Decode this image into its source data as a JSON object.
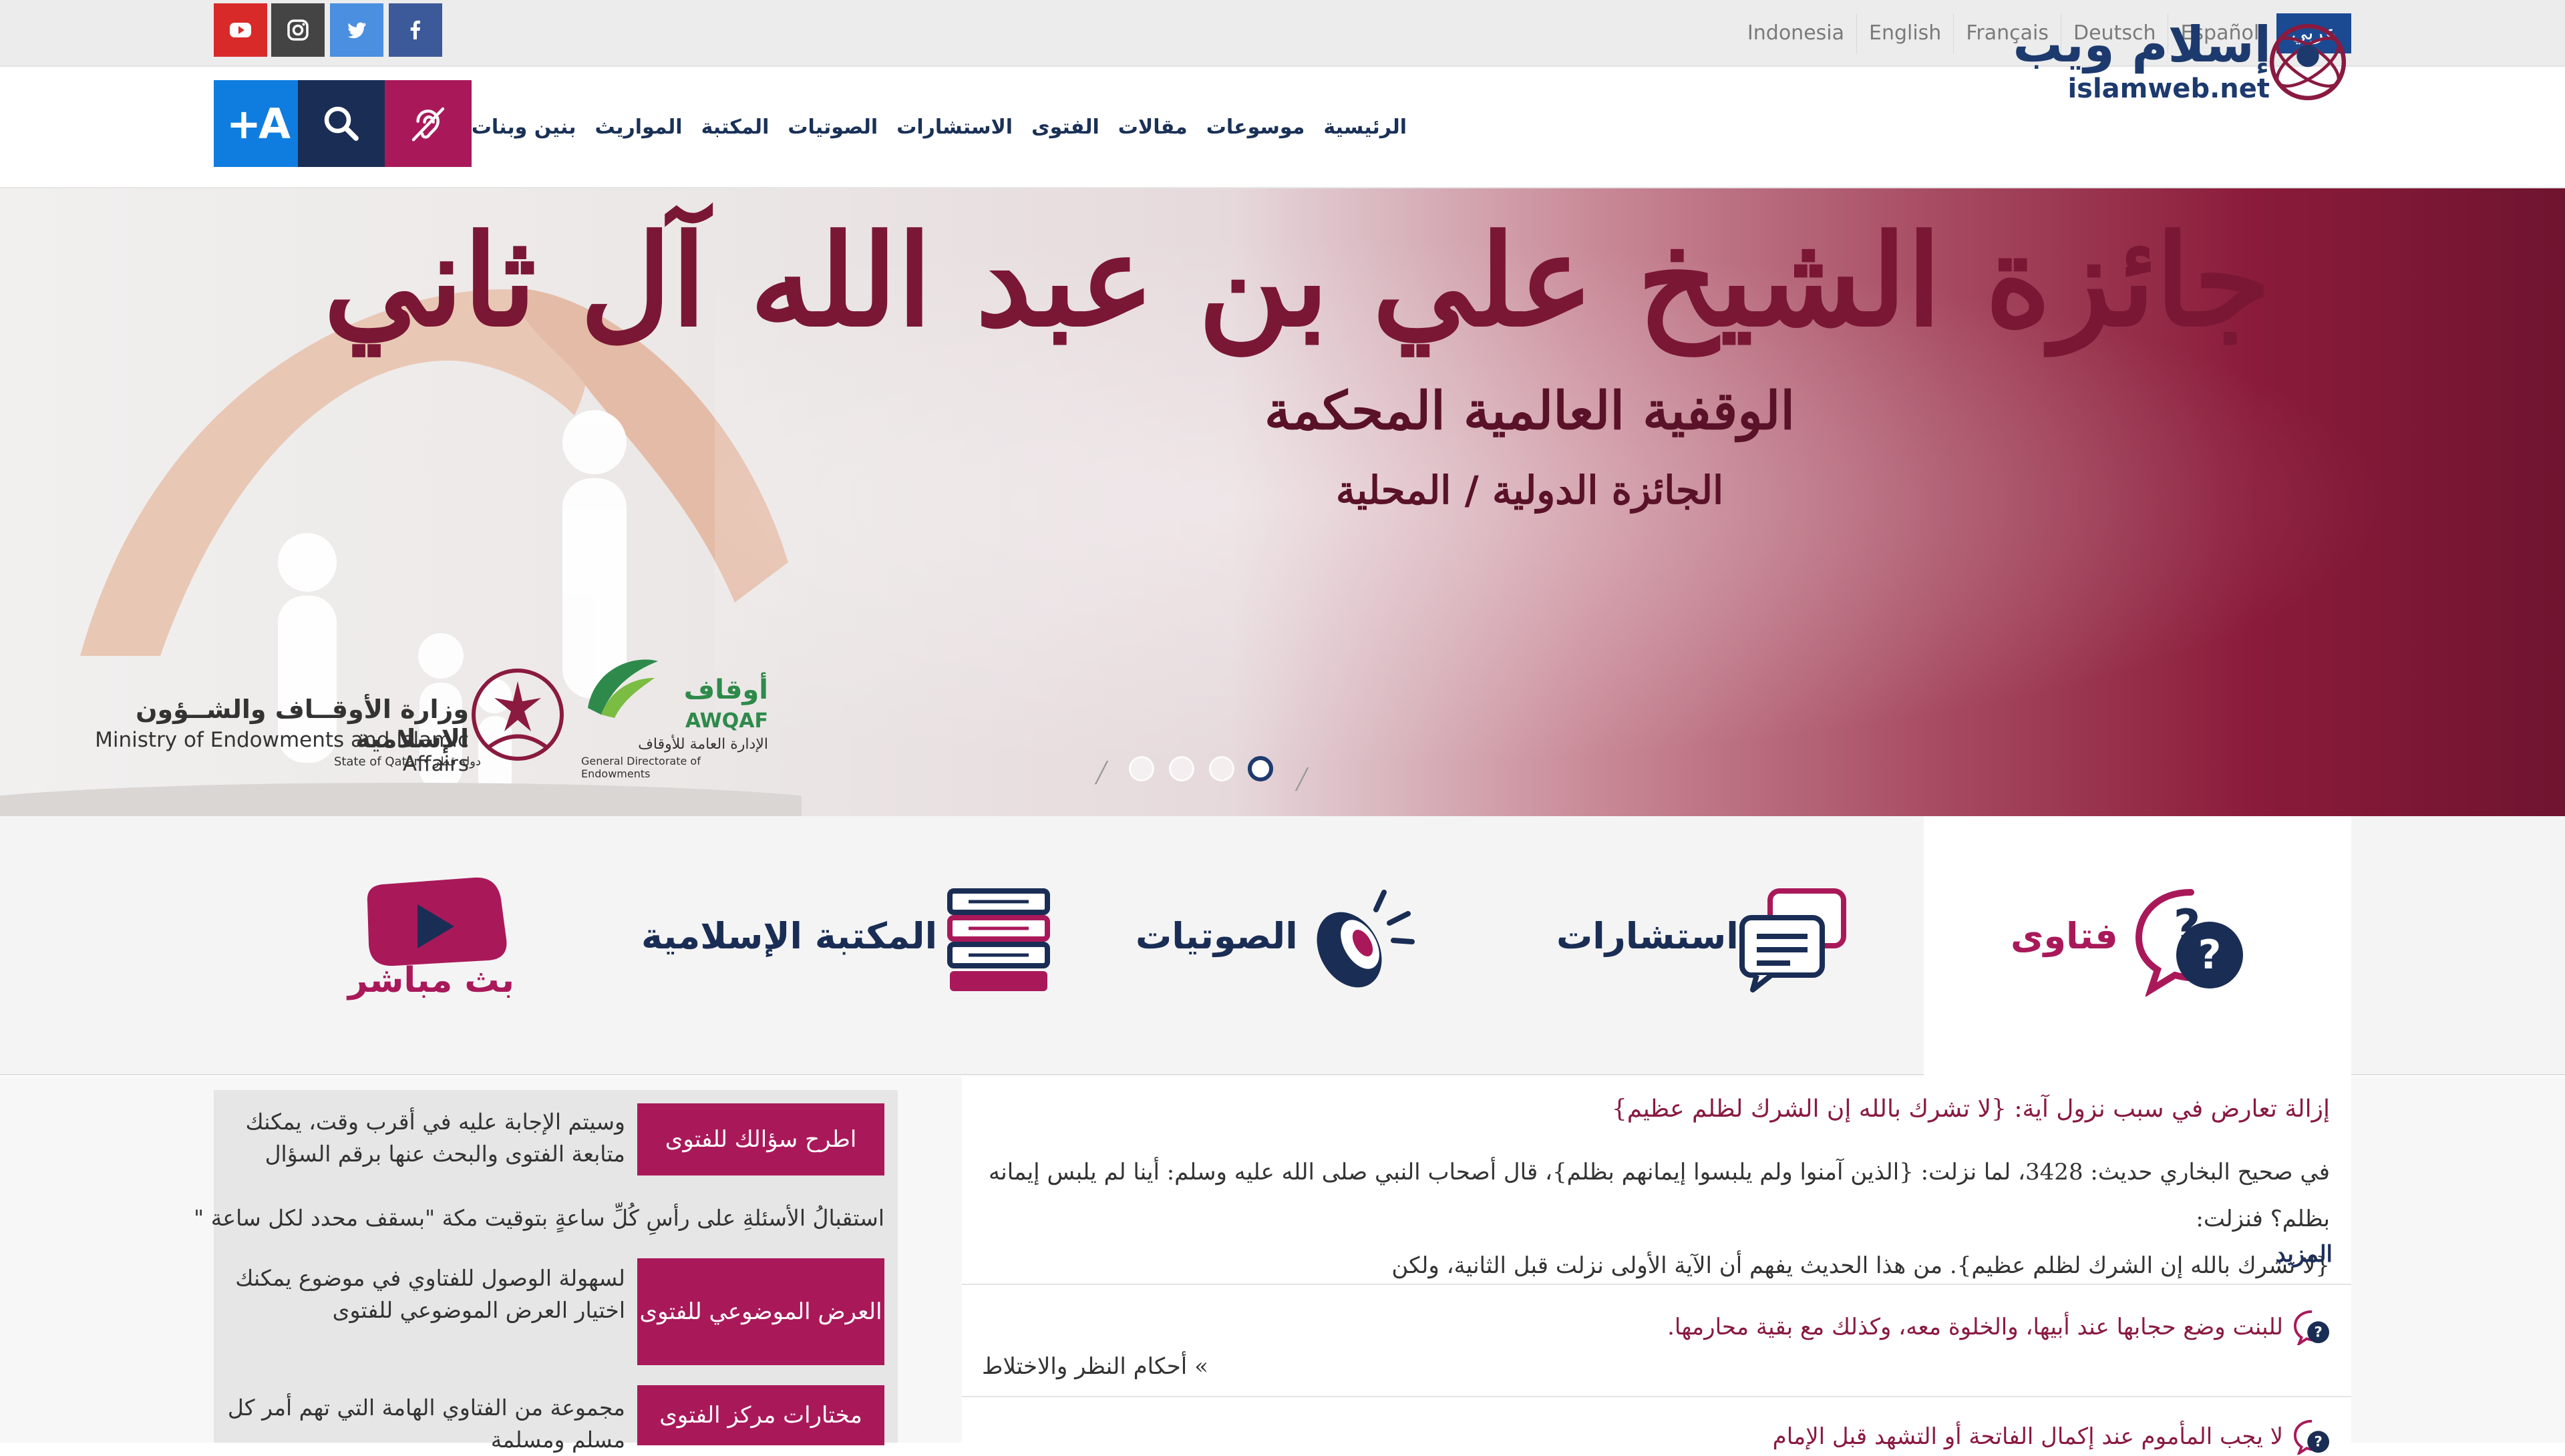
{
  "social": [
    {
      "name": "youtube",
      "icon": "youtube-icon",
      "color": "#d92a2a"
    },
    {
      "name": "instagram",
      "icon": "instagram-icon",
      "color": "#444444"
    },
    {
      "name": "twitter",
      "icon": "twitter-icon",
      "color": "#4a8fe0"
    },
    {
      "name": "facebook",
      "icon": "facebook-icon",
      "color": "#3c5a99"
    }
  ],
  "languages": [
    {
      "label": "Indonesia",
      "active": false
    },
    {
      "label": "English",
      "active": false
    },
    {
      "label": "Français",
      "active": false
    },
    {
      "label": "Deutsch",
      "active": false
    },
    {
      "label": "Español",
      "active": false
    },
    {
      "label": "عربي",
      "active": true
    }
  ],
  "logo": {
    "arabic": "إسلام ويب",
    "latin": "islamweb.net"
  },
  "nav": [
    {
      "label": "الرئيسية"
    },
    {
      "label": "موسوعات"
    },
    {
      "label": "مقالات"
    },
    {
      "label": "الفتوى"
    },
    {
      "label": "الاستشارات"
    },
    {
      "label": "الصوتيات"
    },
    {
      "label": "المكتبة"
    },
    {
      "label": "المواريث"
    },
    {
      "label": "بنين وبنات"
    }
  ],
  "nav_buttons": {
    "accessibility_icon": "hearing-icon",
    "search_icon": "search-icon",
    "font_size_label": "+A"
  },
  "colors": {
    "primary": "#1d3a6e",
    "accent": "#a9195a",
    "brand_blue": "#0f7de0",
    "navy": "#1a2d55"
  },
  "hero": {
    "title": "جائزة الشيخ علي بن عبد الله آل ثاني",
    "subtitle": "الوقفية العالمية المحكمة",
    "subtitle2": "الجائزة الدولية / المحلية",
    "ministry_ar": "وزارة الأوقــاف والشــؤون الإسلامية",
    "ministry_en": "Ministry of Endowments and Islamic Affairs",
    "ministry_state": "State of Qatar • دولة قطر",
    "awqaf_ar": "أوقاف",
    "awqaf_en": "AWQAF",
    "awqaf_sub_ar": "الإدارة العامة للأوقاف",
    "awqaf_sub_en": "General Directorate of Endowments",
    "slides": 4,
    "active_slide": 4
  },
  "sections": [
    {
      "label": "فتاوى",
      "icon": "fatwa-question-icon"
    },
    {
      "label": "استشارات",
      "icon": "consultation-chat-icon"
    },
    {
      "label": "الصوتيات",
      "icon": "audio-speaker-icon"
    },
    {
      "label": "المكتبة الإسلامية",
      "icon": "books-icon"
    },
    {
      "label": "بث مباشر",
      "icon": "live-play-icon"
    }
  ],
  "panel": {
    "ask_button": "اطرح سؤالك للفتوى",
    "ask_text": "وسيتم الإجابة عليه في أقرب وقت، يمكنك متابعة الفتوى والبحث عنها برقم السؤال",
    "reception_text": "استقبالُ الأسئلةِ على رأسِ كُلِّ ساعةٍ بتوقيت مكة \"بسقف محدد لكل ساعة \"",
    "topical_button": "العرض الموضوعي للفتوى",
    "topical_text": "لسهولة الوصول للفتاوي في موضوع يمكنك اختيار العرض الموضوعي للفتوى",
    "selected_button": "مختارات مركز الفتوى",
    "selected_text": "مجموعة من الفتاوي الهامة التي تهم أمر كل مسلم ومسلمة"
  },
  "article": {
    "title": "إزالة تعارض في سبب نزول آية: {لا تشرك بالله إن الشرك لظلم عظيم}",
    "body_line1": "في صحيح البخاري حديث: 3428، لما نزلت: {الذين آمنوا ولم يلبسوا إيمانهم بظلم}، قال أصحاب النبي صلى الله عليه وسلم: أينا لم يلبس إيمانه بظلم؟ فنزلت:",
    "body_line2": "{لا تشرك بالله إن الشرك لظلم عظيم}. من هذا الحديث يفهم أن الآية الأولى نزلت قبل الثانية، ولكن",
    "more": "المزيد",
    "fatwa1": "للبنت وضع حجابها عند أبيها، والخلوة معه، وكذلك مع بقية محارمها.",
    "fatwa1_category": "أحكام النظر والاختلاط",
    "fatwa2": "لا يجب المأموم عند إكمال الفاتحة أو التشهد قبل الإمام"
  }
}
